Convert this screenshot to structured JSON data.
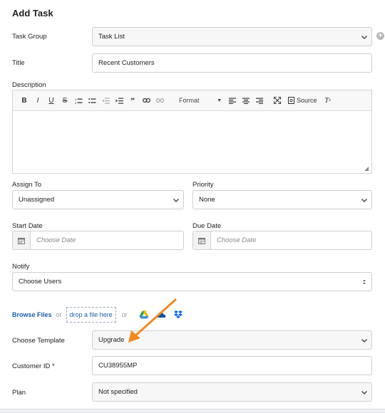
{
  "dialog": {
    "title": "Add Task"
  },
  "task_group": {
    "label": "Task Group",
    "value": "Task List"
  },
  "title_field": {
    "label": "Title",
    "value": "Recent Customers"
  },
  "description": {
    "label": "Description",
    "toolbar": {
      "bold": "B",
      "italic": "I",
      "underline": "U",
      "strike": "S",
      "format": "Format",
      "source": "Source",
      "clear": "Tx",
      "blockquote": "99"
    }
  },
  "assign_to": {
    "label": "Assign To",
    "value": "Unassigned"
  },
  "priority": {
    "label": "Priority",
    "value": "None"
  },
  "start_date": {
    "label": "Start Date",
    "placeholder": "Choose Date"
  },
  "due_date": {
    "label": "Due Date",
    "placeholder": "Choose Date"
  },
  "notify": {
    "label": "Notify",
    "value": "Choose Users"
  },
  "upload": {
    "browse": "Browse Files",
    "or1": "or",
    "drop": "drop a file here",
    "or2": "or"
  },
  "choose_template": {
    "label": "Choose Template",
    "value": "Upgrade"
  },
  "customer_id": {
    "label": "Customer ID *",
    "value": "CU38955MP"
  },
  "plan": {
    "label": "Plan",
    "value": "Not specified"
  },
  "colors": {
    "arrow": "#f28a1e",
    "link": "#1b5fa8"
  }
}
